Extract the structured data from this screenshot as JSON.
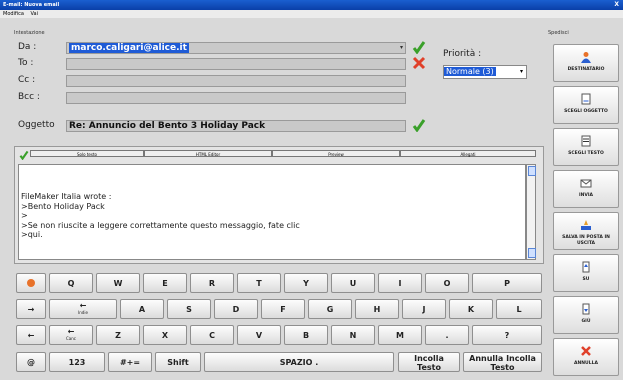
{
  "window": {
    "title": "E-mail: Nuova email",
    "close": "X"
  },
  "menubar": [
    "Modifica",
    "Vai"
  ],
  "addressing": {
    "section_label": "Intestazione",
    "da_label": "Da :",
    "da_value": "marco.caligari@alice.it",
    "to_label": "To :",
    "cc_label": "Cc :",
    "bcc_label": "Bcc :",
    "subject_label": "Oggetto",
    "subject_value": "Re: Annuncio del Bento 3 Holiday Pack"
  },
  "priority": {
    "label": "Priorità :",
    "value": "Normale (3)"
  },
  "editor": {
    "tabs": [
      "Solo testo",
      "HTML Editor",
      "Preview",
      "Allegati"
    ],
    "lines": [
      "FileMaker Italia wrote :",
      ">Bento Holiday Pack",
      ">",
      ">Se non riuscite a leggere correttamente questo messaggio, fate clic",
      ">qui."
    ]
  },
  "keyboard": {
    "row1": [
      "Q",
      "W",
      "E",
      "R",
      "T",
      "Y",
      "U",
      "I",
      "O",
      "P"
    ],
    "row2": [
      "A",
      "S",
      "D",
      "F",
      "G",
      "H",
      "J",
      "K",
      "L"
    ],
    "row3": [
      "Z",
      "X",
      "C",
      "V",
      "B",
      "N",
      "M",
      ".",
      "?"
    ],
    "indietro_label": "Indie",
    "canc_label": "Canc",
    "bottom": {
      "num": "123",
      "sym": "#+=",
      "shift": "Shift",
      "space": "SPAZIO .",
      "incolla": "Incolla Testo",
      "annulla_incolla": "Annulla Incolla Testo"
    }
  },
  "sidebar": {
    "section_label": "Spedisci",
    "buttons": [
      "DESTINATARIO",
      "SCEGLI OGGETTO",
      "SCEGLI TESTO",
      "INVIA",
      "SALVA IN POSTA IN USCITA",
      "SU",
      "GIÙ",
      "ANNULLA"
    ]
  },
  "colors": {
    "accent": "#1f5bd6",
    "ok": "#3aa02a",
    "cancel": "#e0402a"
  }
}
